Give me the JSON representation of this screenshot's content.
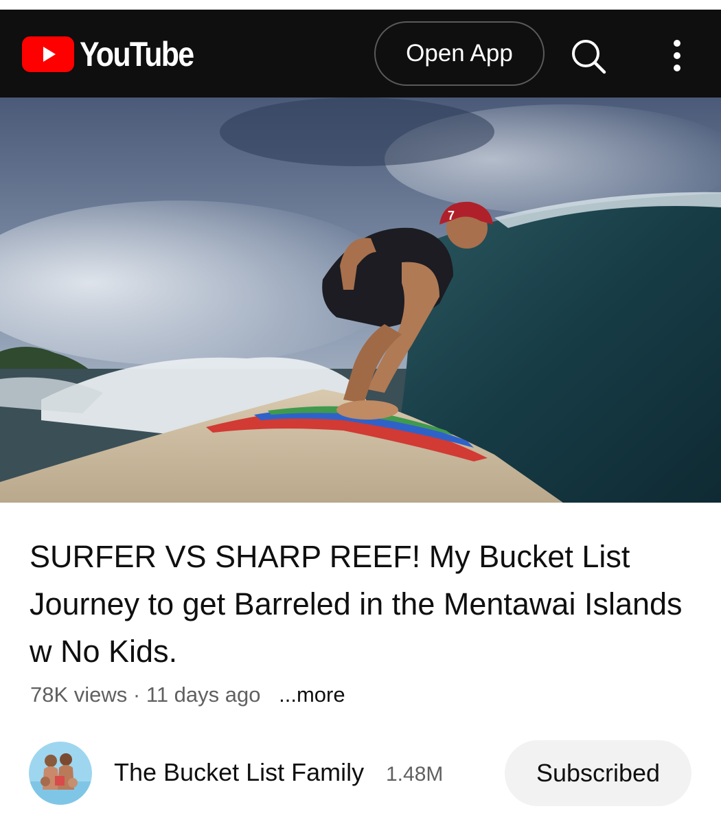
{
  "header": {
    "logo_text": "YouTube",
    "open_app_label": "Open App",
    "search_icon": "search-icon",
    "more_icon": "more-vertical-icon"
  },
  "video": {
    "title": "SURFER VS SHARP REEF! My Bucket List Journey to get Barreled in the Mentawai Islands w No Kids.",
    "views": "78K views",
    "separator": "·",
    "age": "11 days ago",
    "more_label": "...more"
  },
  "channel": {
    "name": "The Bucket List Family",
    "subscribers": "1.48M",
    "subscribe_state_label": "Subscribed"
  },
  "colors": {
    "brand_red": "#ff0000",
    "topbar_bg": "#0f0f0f",
    "subscribed_bg": "#f2f2f2"
  }
}
